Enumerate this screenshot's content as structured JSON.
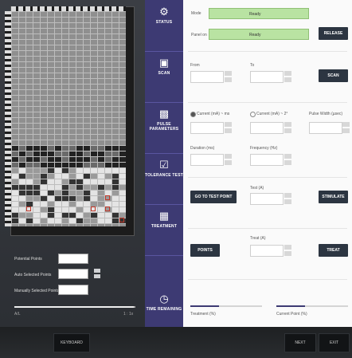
{
  "nav": {
    "items": [
      {
        "label": "STATUS",
        "icon": "gear-icon"
      },
      {
        "label": "SCAN",
        "icon": "scan-icon"
      },
      {
        "label": "PULSE PARAMETERS",
        "icon": "bar-chart-icon"
      },
      {
        "label": "TOLERANCE TEST",
        "icon": "checkbox-icon"
      },
      {
        "label": "TREATMENT",
        "icon": "grid-icon"
      },
      {
        "label": "TIME REMAINING",
        "icon": "timer-icon"
      }
    ]
  },
  "status": {
    "mode_label": "Mode",
    "mode_value": "Ready",
    "panel_label": "Panel on",
    "panel_value": "Ready",
    "release_button": "RELEASE"
  },
  "scan": {
    "from_label": "From",
    "to_label": "To",
    "scan_button": "SCAN"
  },
  "pulse": {
    "current_a_label": "Current (mA) ~ ms",
    "current_b_label": "Current (mA) ~ 2°",
    "pulse_width_label": "Pulse Width (µsec)",
    "duration_label": "Duration (ms)",
    "frequency_label": "Frequency (Hz)"
  },
  "tolerance": {
    "go_button": "GO TO TEST POINT",
    "field_label": "Test (A)",
    "stimulate_button": "STIMULATE"
  },
  "treatment": {
    "points_button": "POINTS",
    "field_label": "Treat (A)",
    "treat_button": "TREAT"
  },
  "time": {
    "treatment_label": "Treatment (%)",
    "treatment_progress": 0.4,
    "current_point_label": "Current Point (%)",
    "current_progress": 0.4
  },
  "left": {
    "potential_points_label": "Potential Points",
    "auto_selected_label": "Auto Selected Points",
    "manually_selected_label": "Manually Selected Points",
    "slider_min": "A/L",
    "slider_max": "1 : 1x"
  },
  "bottom": {
    "keyboard_button": "KEYBOARD",
    "next_button": "NEXT",
    "exit_button": "EXIT"
  },
  "colors": {
    "nav_bg": "#3d3a73",
    "button_bg": "#2c3541",
    "ready_green": "#b9e3a2"
  }
}
